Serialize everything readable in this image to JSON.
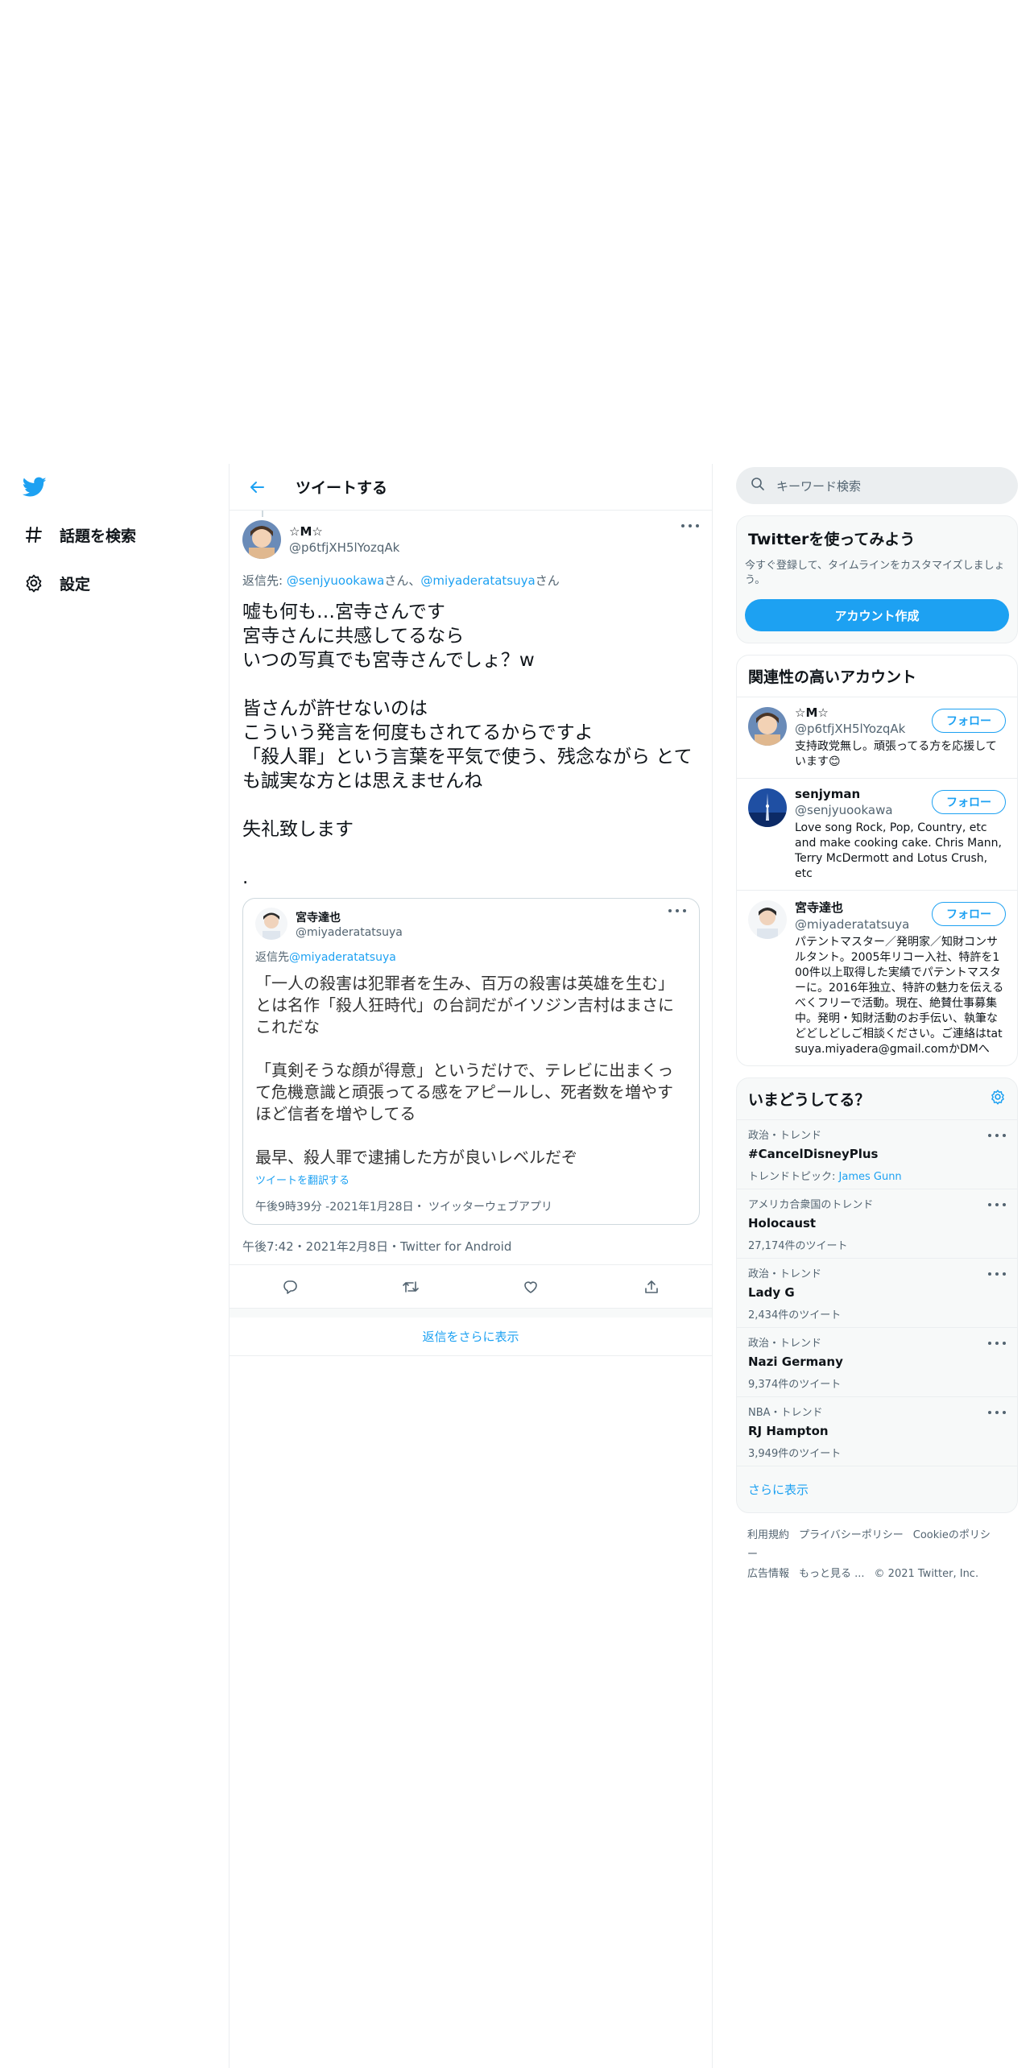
{
  "nav": {
    "items": [
      {
        "label": "話題を検索",
        "icon": "hashtag-icon"
      },
      {
        "label": "設定",
        "icon": "gear-icon"
      }
    ]
  },
  "header": {
    "title": "ツイートする"
  },
  "tweet": {
    "name": "☆M☆",
    "handle": "@p6tfjXH5lYozqAk",
    "reply_prefix": "返信先: ",
    "reply_user1": "@senjyuookawa",
    "reply_sep": "さん、",
    "reply_user2": "@miyaderatatsuya",
    "reply_suffix": "さん",
    "text": "嘘も何も…宮寺さんです\n宮寺さんに共感してるなら\nいつの写真でも宮寺さんでしょ？w\n\n皆さんが許せないのは\nこういう発言を何度もされてるからですよ\n「殺人罪」という言葉を平気で使う、残念ながら とても誠実な方とは思えませんね\n\n失礼致します\n\n.",
    "meta": "午後7:42・2021年2月8日・Twitter for Android"
  },
  "quote": {
    "name": "宮寺達也",
    "handle": "@miyaderatatsuya",
    "reply_prefix": "返信先",
    "reply_user": "@miyaderatatsuya",
    "text": "「一人の殺害は犯罪者を生み、百万の殺害は英雄を生む」とは名作「殺人狂時代」の台詞だがイソジン吉村はまさにこれだな\n\n「真剣そうな顔が得意」というだけで、テレビに出まくって危機意識と頑張ってる感をアピールし、死者数を増やすほど信者を増やしてる\n\n最早、殺人罪で逮捕した方が良いレベルだぞ",
    "translate": "ツイートを翻訳する",
    "meta": "午後9時39分 -2021年1月28日・ ツイッターウェブアプリ"
  },
  "more_replies": "返信をさらに表示",
  "search": {
    "placeholder": "キーワード検索"
  },
  "signup": {
    "title": "Twitterを使ってみよう",
    "desc": "今すぐ登録して、タイムラインをカスタマイズしましょう。",
    "button": "アカウント作成"
  },
  "related": {
    "title": "関連性の高いアカウント",
    "follow_label": "フォロー",
    "accounts": [
      {
        "name": "☆M☆",
        "handle": "@p6tfjXH5lYozqAk",
        "bio": "支持政党無し。頑張ってる方を応援しています😊"
      },
      {
        "name": "senjyman",
        "handle": "@senjyuookawa",
        "bio": "Love song Rock, Pop, Country, etc and make cooking cake. Chris Mann, Terry McDermott and Lotus Crush, etc"
      },
      {
        "name": "宮寺達也",
        "handle": "@miyaderatatsuya",
        "bio": "パテントマスター／発明家／知財コンサルタント。2005年リコー入社、特許を100件以上取得した実績でパテントマスターに。2016年独立、特許の魅力を伝えるべくフリーで活動。現在、絶賛仕事募集中。発明・知財活動のお手伝い、執筆などどしどしご相談ください。ご連絡はtatsuya.miyadera@gmail.comかDMへ"
      }
    ]
  },
  "trends": {
    "title": "いまどうしてる？",
    "items": [
      {
        "context": "政治・トレンド",
        "name": "#CancelDisneyPlus",
        "extra_prefix": "トレンドトピック: ",
        "extra_link": "James Gunn"
      },
      {
        "context": "アメリカ合衆国のトレンド",
        "name": "Holocaust",
        "count": "27,174件のツイート"
      },
      {
        "context": "政治・トレンド",
        "name": "Lady G",
        "count": "2,434件のツイート"
      },
      {
        "context": "政治・トレンド",
        "name": "Nazi Germany",
        "count": "9,374件のツイート"
      },
      {
        "context": "NBA・トレンド",
        "name": "RJ Hampton",
        "count": "3,949件のツイート"
      }
    ],
    "show_more": "さらに表示"
  },
  "footer": {
    "links": [
      "利用規約",
      "プライバシーポリシー",
      "Cookieのポリシー",
      "広告情報",
      "もっと見る ..."
    ],
    "copyright": "© 2021 Twitter, Inc."
  },
  "colors": {
    "accent": "#1da1f2",
    "text": "#0f1419",
    "secondary": "#536471",
    "border": "#ebeef0"
  }
}
